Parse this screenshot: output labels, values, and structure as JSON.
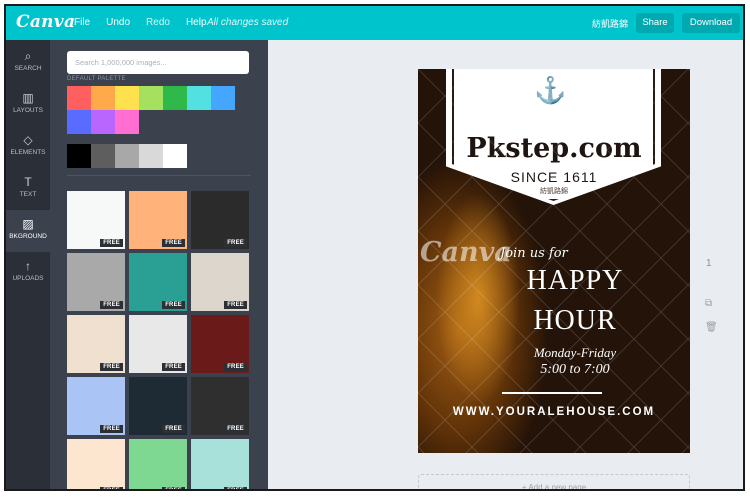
{
  "app": {
    "logo": "Canva",
    "menu": {
      "file": "File",
      "undo": "Undo",
      "redo": "Redo",
      "help": "Help"
    },
    "status": "All changes saved",
    "username": "紡凱路錦",
    "share_label": "Share",
    "download_label": "Download"
  },
  "leftnav": [
    {
      "label": "SEARCH",
      "icon": "search-icon",
      "glyph": "⌕"
    },
    {
      "label": "LAYOUTS",
      "icon": "layouts-icon",
      "glyph": "▥"
    },
    {
      "label": "ELEMENTS",
      "icon": "elements-icon",
      "glyph": "◇"
    },
    {
      "label": "TEXT",
      "icon": "text-icon",
      "glyph": "T"
    },
    {
      "label": "BKGROUND",
      "icon": "background-icon",
      "glyph": "▨"
    },
    {
      "label": "UPLOADS",
      "icon": "uploads-icon",
      "glyph": "↑"
    }
  ],
  "panel": {
    "search_placeholder": "Search 1,000,000 images...",
    "palette_label": "DEFAULT PALETTE",
    "palette": [
      "#ff5f5f",
      "#ffa94a",
      "#ffe14d",
      "#a6e05f",
      "#2fb94b",
      "#52e0e0",
      "#45a6ff",
      "#5a6cff",
      "#b866ff",
      "#ff6ed0"
    ],
    "grays": [
      "#000000",
      "#5e5e5e",
      "#a8a8a8",
      "#d9d9d9",
      "#ffffff"
    ],
    "free_label": "FREE",
    "tiles": [
      "#f7f8f8",
      "#ffb27a",
      "#2b2b2b",
      "#a9a9a9",
      "#2aa094",
      "#ddd6cc",
      "#efe0d0",
      "#e8e8e8",
      "#6b1a1a",
      "#a9c4f5",
      "#1e2a34",
      "#2f2f2f",
      "#fde6cf",
      "#7fd891",
      "#a8e0da"
    ]
  },
  "design": {
    "brand": "Pkstep.com",
    "since": "SINCE 1611",
    "since_sub": "紡凱路錦",
    "watermark": "Canva",
    "join": "Join us for",
    "happy": "HAPPY",
    "hour": "HOUR",
    "days": "Monday-Friday",
    "time": "5:00 to 7:00",
    "url": "WWW.YOURALEHOUSE.COM"
  },
  "canvas": {
    "page_number": "1",
    "add_page": "+ Add a new page"
  }
}
